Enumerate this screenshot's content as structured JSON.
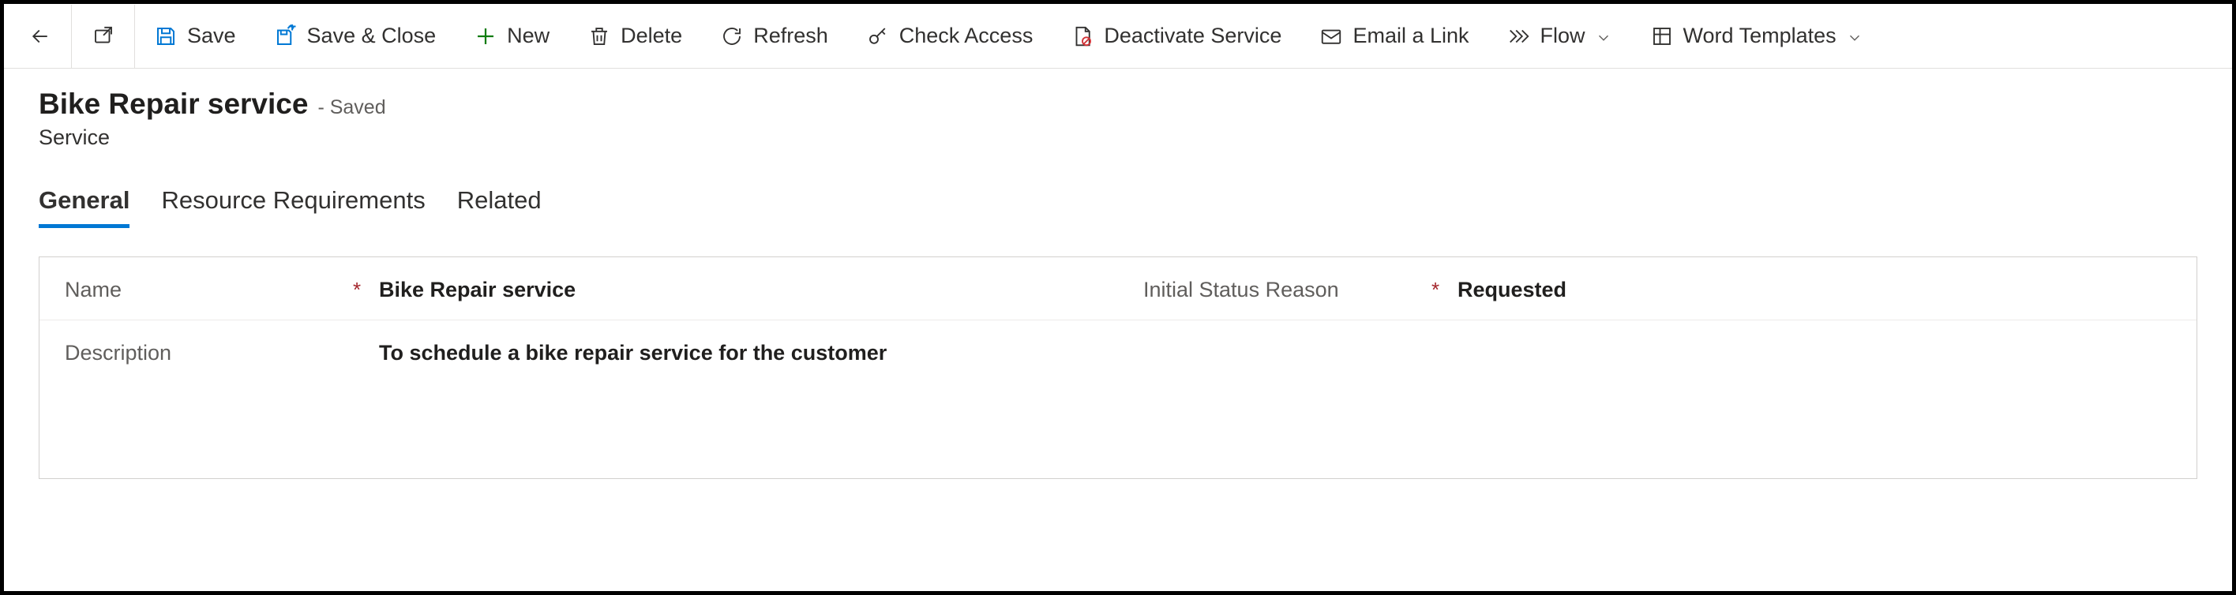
{
  "commands": {
    "save": "Save",
    "save_close": "Save & Close",
    "new": "New",
    "delete": "Delete",
    "refresh": "Refresh",
    "check_access": "Check Access",
    "deactivate": "Deactivate Service",
    "email_link": "Email a Link",
    "flow": "Flow",
    "word_templates": "Word Templates"
  },
  "record": {
    "title": "Bike Repair service",
    "saved_suffix": "- Saved",
    "entity_type": "Service"
  },
  "tabs": {
    "general": "General",
    "resource_req": "Resource Requirements",
    "related": "Related"
  },
  "fields": {
    "name_label": "Name",
    "name_value": "Bike Repair service",
    "status_label": "Initial Status Reason",
    "status_value": "Requested",
    "desc_label": "Description",
    "desc_value": "To schedule a bike repair service for the customer",
    "required": "*"
  }
}
